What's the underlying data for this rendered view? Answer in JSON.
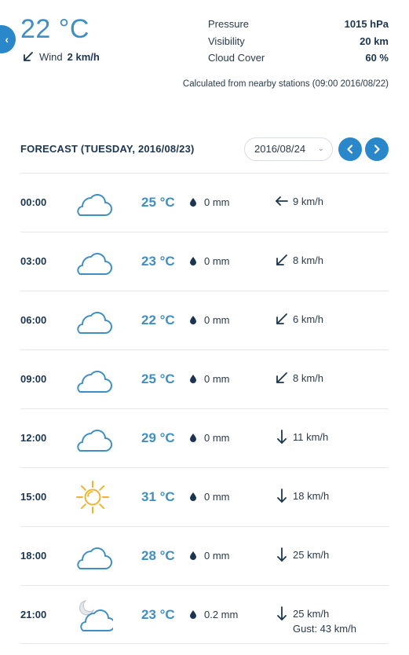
{
  "current": {
    "temperature": "22 °C",
    "wind_label": "Wind",
    "wind_value": "2 km/h",
    "wind_direction": "sw"
  },
  "stats": [
    {
      "label": "Pressure",
      "value": "1015 hPa"
    },
    {
      "label": "Visibility",
      "value": "20 km"
    },
    {
      "label": "Cloud Cover",
      "value": "60 %"
    }
  ],
  "calc_note": "Calculated from nearby stations (09:00 2016/08/22)",
  "forecast": {
    "title": "FORECAST (TUESDAY, 2016/08/23)",
    "selected_date": "2016/08/24",
    "rows": [
      {
        "time": "00:00",
        "icon": "cloud-icon",
        "temp": "25 °C",
        "precip": "0 mm",
        "wind_dir": "w",
        "wind": "9 km/h",
        "gust": ""
      },
      {
        "time": "03:00",
        "icon": "cloud-icon",
        "temp": "23 °C",
        "precip": "0 mm",
        "wind_dir": "sw",
        "wind": "8 km/h",
        "gust": ""
      },
      {
        "time": "06:00",
        "icon": "cloud-icon",
        "temp": "22 °C",
        "precip": "0 mm",
        "wind_dir": "sw",
        "wind": "6 km/h",
        "gust": ""
      },
      {
        "time": "09:00",
        "icon": "cloud-icon",
        "temp": "25 °C",
        "precip": "0 mm",
        "wind_dir": "sw",
        "wind": "8 km/h",
        "gust": ""
      },
      {
        "time": "12:00",
        "icon": "cloud-icon",
        "temp": "29 °C",
        "precip": "0 mm",
        "wind_dir": "s",
        "wind": "11 km/h",
        "gust": ""
      },
      {
        "time": "15:00",
        "icon": "sun-icon",
        "temp": "31 °C",
        "precip": "0 mm",
        "wind_dir": "s",
        "wind": "18 km/h",
        "gust": ""
      },
      {
        "time": "18:00",
        "icon": "cloud-icon",
        "temp": "28 °C",
        "precip": "0 mm",
        "wind_dir": "s",
        "wind": "25 km/h",
        "gust": ""
      },
      {
        "time": "21:00",
        "icon": "moon-cloud-icon",
        "temp": "23 °C",
        "precip": "0.2 mm",
        "wind_dir": "s",
        "wind": "25 km/h",
        "gust": "Gust: 43 km/h"
      }
    ]
  },
  "colors": {
    "accent": "#2a87c9",
    "temperature": "#3f8fc4",
    "text_dark": "#1b3550",
    "sun": "#f0b429"
  }
}
